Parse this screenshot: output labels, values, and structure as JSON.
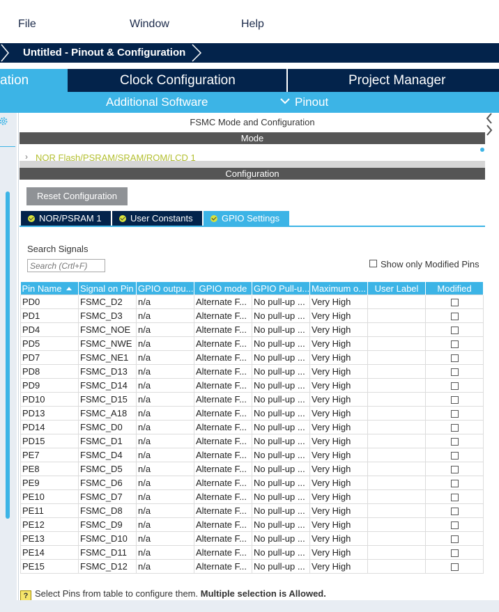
{
  "menu": {
    "file": "File",
    "window": "Window",
    "help": "Help"
  },
  "breadcrumb": {
    "title": "Untitled - Pinout & Configuration"
  },
  "tabs": {
    "pinout_partial": "ation",
    "clock": "Clock Configuration",
    "project": "Project Manager"
  },
  "subtabs": {
    "additional_software": "Additional Software",
    "pinout": "Pinout"
  },
  "panel": {
    "title": "FSMC Mode and Configuration",
    "mode_header": "Mode",
    "nor_flash_link": "NOR Flash/PSRAM/SRAM/ROM/LCD 1",
    "config_header": "Configuration",
    "reset_button": "Reset Configuration",
    "config_tabs": [
      "NOR/PSRAM 1",
      "User Constants",
      "GPIO Settings"
    ]
  },
  "search": {
    "label": "Search Signals",
    "placeholder": "Search (Crtl+F)",
    "modified_only": "Show only Modified Pins"
  },
  "table": {
    "headers": [
      "Pin Name",
      "Signal on Pin",
      "GPIO outpu...",
      "GPIO mode",
      "GPIO Pull-u...",
      "Maximum o...",
      "User Label",
      "Modified"
    ],
    "rows": [
      [
        "PD0",
        "FSMC_D2",
        "n/a",
        "Alternate F...",
        "No pull-up ...",
        "Very High"
      ],
      [
        "PD1",
        "FSMC_D3",
        "n/a",
        "Alternate F...",
        "No pull-up ...",
        "Very High"
      ],
      [
        "PD4",
        "FSMC_NOE",
        "n/a",
        "Alternate F...",
        "No pull-up ...",
        "Very High"
      ],
      [
        "PD5",
        "FSMC_NWE",
        "n/a",
        "Alternate F...",
        "No pull-up ...",
        "Very High"
      ],
      [
        "PD7",
        "FSMC_NE1",
        "n/a",
        "Alternate F...",
        "No pull-up ...",
        "Very High"
      ],
      [
        "PD8",
        "FSMC_D13",
        "n/a",
        "Alternate F...",
        "No pull-up ...",
        "Very High"
      ],
      [
        "PD9",
        "FSMC_D14",
        "n/a",
        "Alternate F...",
        "No pull-up ...",
        "Very High"
      ],
      [
        "PD10",
        "FSMC_D15",
        "n/a",
        "Alternate F...",
        "No pull-up ...",
        "Very High"
      ],
      [
        "PD13",
        "FSMC_A18",
        "n/a",
        "Alternate F...",
        "No pull-up ...",
        "Very High"
      ],
      [
        "PD14",
        "FSMC_D0",
        "n/a",
        "Alternate F...",
        "No pull-up ...",
        "Very High"
      ],
      [
        "PD15",
        "FSMC_D1",
        "n/a",
        "Alternate F...",
        "No pull-up ...",
        "Very High"
      ],
      [
        "PE7",
        "FSMC_D4",
        "n/a",
        "Alternate F...",
        "No pull-up ...",
        "Very High"
      ],
      [
        "PE8",
        "FSMC_D5",
        "n/a",
        "Alternate F...",
        "No pull-up ...",
        "Very High"
      ],
      [
        "PE9",
        "FSMC_D6",
        "n/a",
        "Alternate F...",
        "No pull-up ...",
        "Very High"
      ],
      [
        "PE10",
        "FSMC_D7",
        "n/a",
        "Alternate F...",
        "No pull-up ...",
        "Very High"
      ],
      [
        "PE11",
        "FSMC_D8",
        "n/a",
        "Alternate F...",
        "No pull-up ...",
        "Very High"
      ],
      [
        "PE12",
        "FSMC_D9",
        "n/a",
        "Alternate F...",
        "No pull-up ...",
        "Very High"
      ],
      [
        "PE13",
        "FSMC_D10",
        "n/a",
        "Alternate F...",
        "No pull-up ...",
        "Very High"
      ],
      [
        "PE14",
        "FSMC_D11",
        "n/a",
        "Alternate F...",
        "No pull-up ...",
        "Very High"
      ],
      [
        "PE15",
        "FSMC_D12",
        "n/a",
        "Alternate F...",
        "No pull-up ...",
        "Very High"
      ]
    ]
  },
  "hint": {
    "normal": "Select Pins from table to configure them.",
    "bold": "Multiple selection is Allowed."
  },
  "colors": {
    "navy": "#03234b",
    "accent": "#3cb4e6",
    "check": "#d7e23c"
  },
  "icons": {
    "settings": "gear-icon",
    "dropdown": "chevron-down-icon",
    "help": "question-icon"
  }
}
